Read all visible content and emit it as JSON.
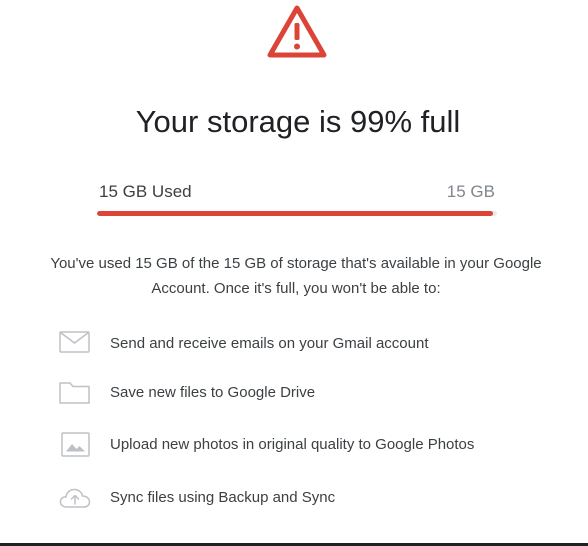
{
  "dialog": {
    "title": "Your storage is 99% full",
    "usage": {
      "used_label": "15 GB Used",
      "total_label": "15 GB",
      "used_fraction": 0.99,
      "bar_color": "#db4437"
    },
    "description": "You've used 15 GB of the 15 GB of storage that's available in your Google Account. Once it's full, you won't be able to:",
    "features": [
      {
        "icon": "mail-icon",
        "text": "Send and receive emails on your Gmail account"
      },
      {
        "icon": "folder-icon",
        "text": "Save new files to Google Drive"
      },
      {
        "icon": "photo-icon",
        "text": "Upload new photos in original quality to Google Photos"
      },
      {
        "icon": "cloud-upload-icon",
        "text": "Sync files using Backup and Sync"
      }
    ]
  },
  "colors": {
    "warning": "#db4437",
    "icon_gray": "#bdc1c6"
  }
}
